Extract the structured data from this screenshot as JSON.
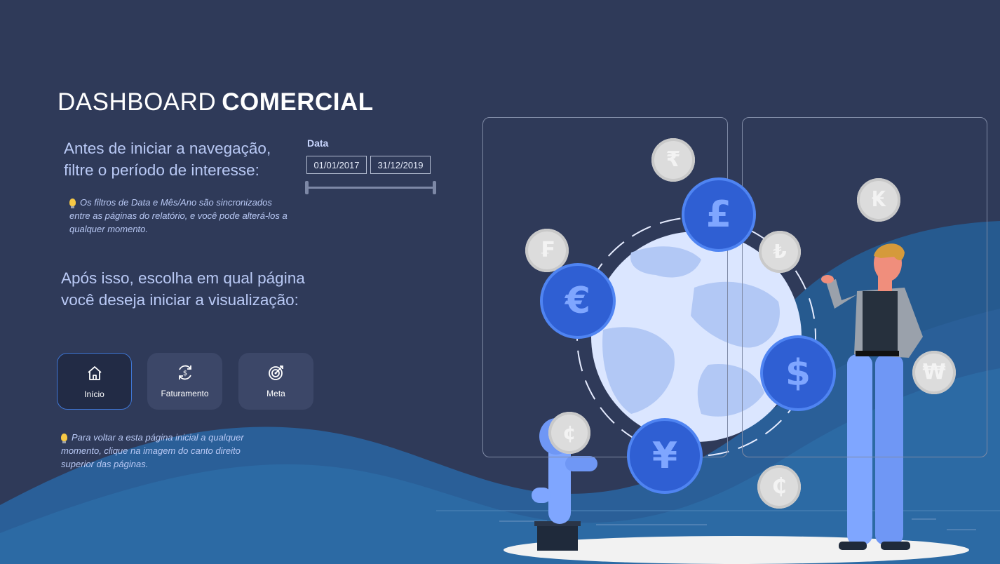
{
  "header": {
    "title_light": "DASHBOARD",
    "title_bold": "COMERCIAL"
  },
  "intro": "Antes de iniciar a navegação, filtre o período de interesse:",
  "filter_note": "Os filtros de Data e Mês/Ano são sincronizados entre as páginas do relatório, e você pode alterá-los a qualquer momento.",
  "after_text": "Após isso, escolha em qual página você deseja iniciar a visualização:",
  "date_filter": {
    "label": "Data",
    "start": "01/01/2017",
    "end": "31/12/2019"
  },
  "nav": [
    {
      "label": "Início",
      "icon": "home-icon",
      "active": true
    },
    {
      "label": "Faturamento",
      "icon": "revenue-icon",
      "active": false
    },
    {
      "label": "Meta",
      "icon": "target-icon",
      "active": false
    }
  ],
  "return_note": "Para voltar a esta página inicial a qualquer momento, clique na imagem do canto direito superior das páginas.",
  "illustration": {
    "small_coins": [
      "₹",
      "₣",
      "₺",
      "₭",
      "₩",
      "₵",
      "¢"
    ],
    "big_coins": [
      "£",
      "€",
      "$",
      "¥"
    ]
  },
  "colors": {
    "background": "#2f3a59",
    "wave": "#2b6aa3",
    "accent": "#3f77d5",
    "coin_blue": "#2f5fd3"
  }
}
